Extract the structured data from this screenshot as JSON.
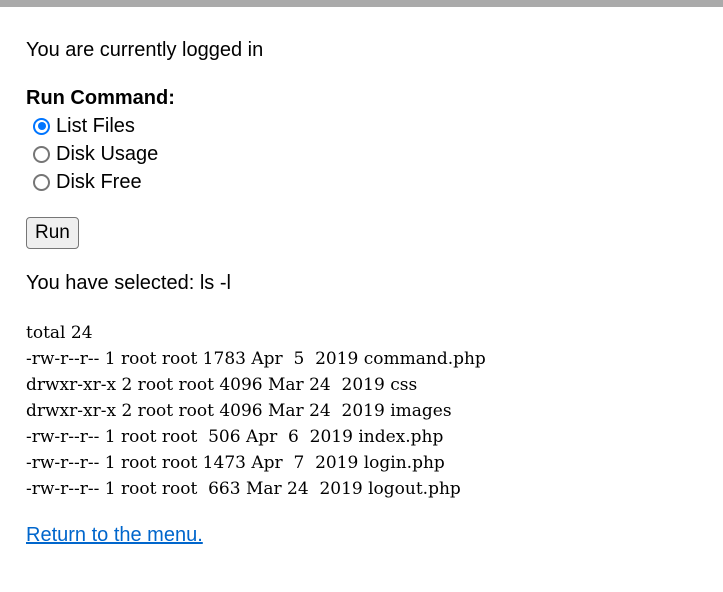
{
  "status": {
    "logged_in_text": "You are currently logged in"
  },
  "form": {
    "label": "Run Command:",
    "options": [
      {
        "label": "List Files",
        "checked": true
      },
      {
        "label": "Disk Usage",
        "checked": false
      },
      {
        "label": "Disk Free",
        "checked": false
      }
    ],
    "run_label": "Run",
    "accent_color": "#0075ff"
  },
  "result": {
    "selected_text": "You have selected: ls -l",
    "output_lines": [
      "total 24",
      "-rw-r--r-- 1 root root 1783 Apr  5  2019 command.php",
      "drwxr-xr-x 2 root root 4096 Mar 24  2019 css",
      "drwxr-xr-x 2 root root 4096 Mar 24  2019 images",
      "-rw-r--r-- 1 root root  506 Apr  6  2019 index.php",
      "-rw-r--r-- 1 root root 1473 Apr  7  2019 login.php",
      "-rw-r--r-- 1 root root  663 Mar 24  2019 logout.php"
    ]
  },
  "footer": {
    "return_link_text": "Return to the menu.",
    "link_color": "#0066cc"
  }
}
